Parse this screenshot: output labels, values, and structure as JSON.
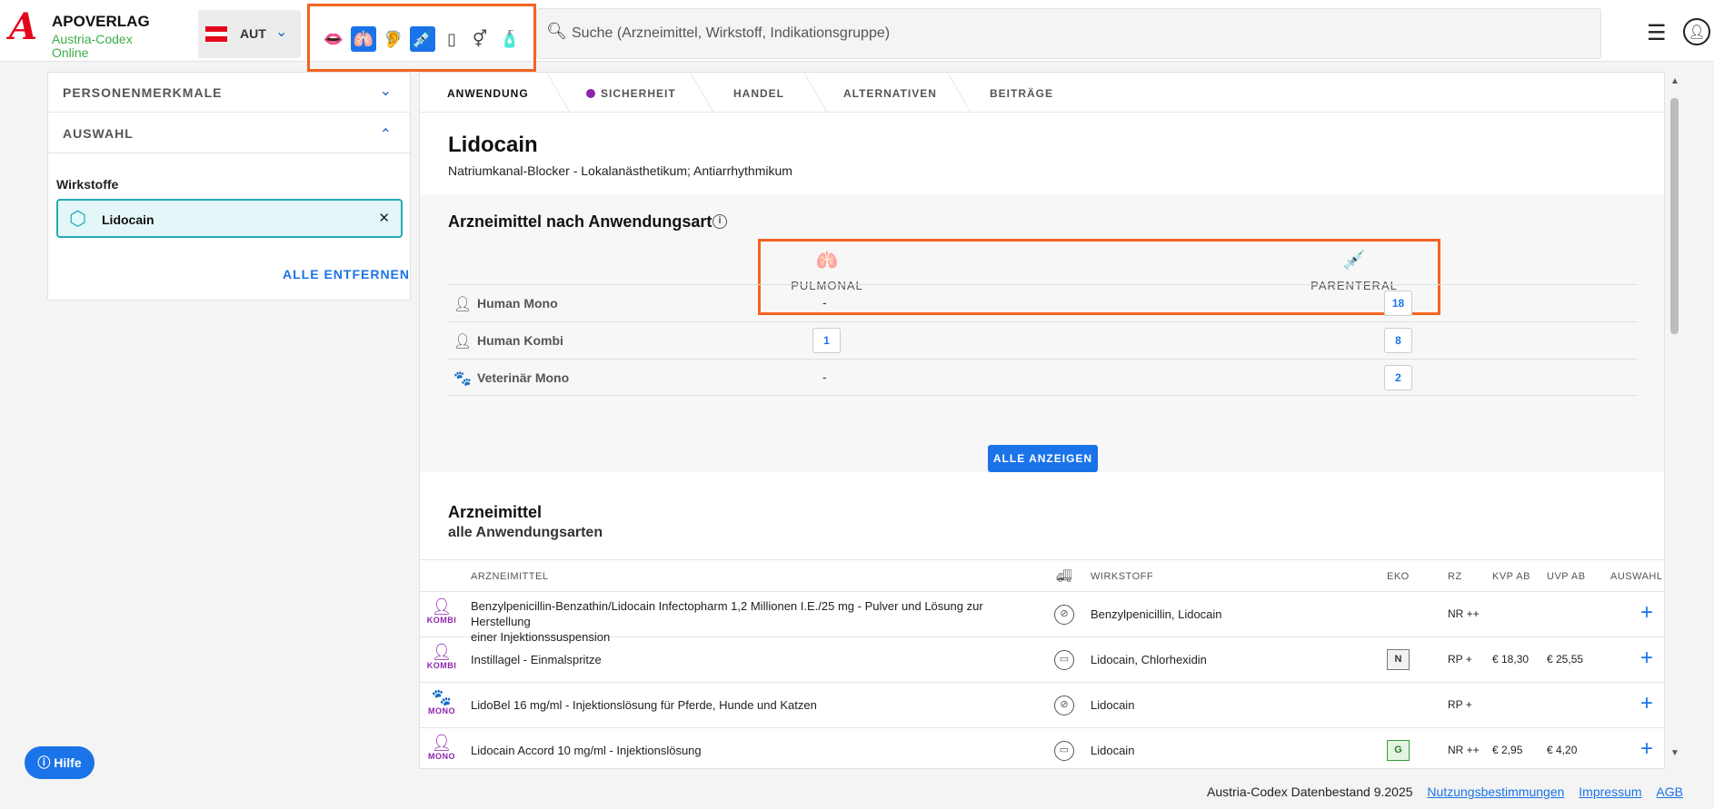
{
  "header": {
    "logo_title": "APOVERLAG",
    "logo_sub1": "Austria-Codex",
    "logo_sub2": "Online",
    "country_code": "AUT",
    "search_placeholder": "Suche (Arzneimittel, Wirkstoff, Indikationsgruppe)"
  },
  "route_icons": [
    {
      "name": "lips-icon",
      "glyph": "👄",
      "active": false
    },
    {
      "name": "lungs-icon",
      "glyph": "🫁",
      "active": true
    },
    {
      "name": "ear-icon",
      "glyph": "🦻",
      "active": false
    },
    {
      "name": "syringe-icon",
      "glyph": "💉",
      "active": true
    },
    {
      "name": "suppository-icon",
      "glyph": "🕯",
      "active": false
    },
    {
      "name": "gender-icon",
      "glyph": "⚥",
      "active": false
    },
    {
      "name": "bottles-icon",
      "glyph": "🧴",
      "active": false
    }
  ],
  "sidebar": {
    "personenmerkmale": "PERSONENMERKMALE",
    "auswahl": "AUSWAHL",
    "wirkstoffe_title": "Wirkstoffe",
    "chip_label": "Lidocain",
    "remove_all": "ALLE ENTFERNEN"
  },
  "tabs": [
    "ANWENDUNG",
    "SICHERHEIT",
    "HANDEL",
    "ALTERNATIVEN",
    "BEITRÄGE"
  ],
  "drug": {
    "title": "Lidocain",
    "subtitle": "Natriumkanal-Blocker - Lokalanästhetikum; Antiarrhythmikum"
  },
  "application": {
    "title": "Arzneimittel nach Anwendungsart",
    "col1": "PULMONAL",
    "col2": "PARENTERAL",
    "rows": [
      {
        "label": "Human Mono",
        "pulmonal": "-",
        "parenteral": "18"
      },
      {
        "label": "Human Kombi",
        "pulmonal": "1",
        "parenteral": "8"
      },
      {
        "label": "Veterinär Mono",
        "pulmonal": "-",
        "parenteral": "2"
      }
    ],
    "show_all": "ALLE ANZEIGEN"
  },
  "list": {
    "title": "Arzneimittel",
    "subtitle": "alle Anwendungsarten",
    "headers": {
      "arzneimittel": "ARZNEIMITTEL",
      "wirkstoff": "WIRKSTOFF",
      "eko": "EKO",
      "rz": "RZ",
      "kvp": "KVP AB",
      "uvp": "UVP AB",
      "auswahl": "AUSWAHL"
    },
    "rows": [
      {
        "badge": "KOMBI",
        "name_line1": "Benzylpenicillin-Benzathin/Lidocain Infectopharm 1,2 Millionen I.E./25 mg - Pulver und Lösung zur Herstellung",
        "name_line2": "einer Injektionssuspension",
        "wirkstoff": "Benzylpenicillin, Lidocain",
        "eko": "",
        "rz": "NR ++",
        "kvp": "",
        "uvp": ""
      },
      {
        "badge": "KOMBI",
        "name_line1": "Instillagel - Einmalspritze",
        "name_line2": "",
        "wirkstoff": "Lidocain, Chlorhexidin",
        "eko": "N",
        "rz": "RP +",
        "kvp": "€ 18,30",
        "uvp": "€ 25,55"
      },
      {
        "badge": "MONO",
        "name_line1": "LidoBel 16 mg/ml - Injektionslösung für Pferde, Hunde und Katzen",
        "name_line2": "",
        "wirkstoff": "Lidocain",
        "eko": "",
        "rz": "RP +",
        "kvp": "",
        "uvp": ""
      },
      {
        "badge": "MONO",
        "name_line1": "Lidocain Accord 10 mg/ml - Injektionslösung",
        "name_line2": "",
        "wirkstoff": "Lidocain",
        "eko": "G",
        "rz": "NR ++",
        "kvp": "€ 2,95",
        "uvp": "€ 4,20"
      }
    ]
  },
  "help_label": "Hilfe",
  "footer": {
    "text": "Austria-Codex Datenbestand 9.2025",
    "link1": "Nutzungsbestimmungen",
    "link2": "Impressum",
    "link3": "AGB"
  },
  "colors": {
    "accent": "#1a73e8",
    "highlight": "#f26322",
    "brand_red": "#e3051b",
    "brand_green": "#3cae49",
    "veterinary_purple": "#8e24aa"
  }
}
